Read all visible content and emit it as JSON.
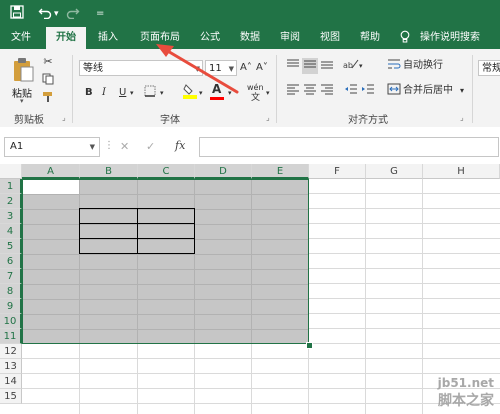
{
  "quick_access": {
    "save_icon": "save-icon",
    "undo_icon": "undo-icon",
    "undo_dropdown": "▾",
    "redo_icon": "redo-icon",
    "customize": "="
  },
  "tabs": [
    {
      "label": "文件",
      "active": false
    },
    {
      "label": "开始",
      "active": true
    },
    {
      "label": "插入",
      "active": false
    },
    {
      "label": "页面布局",
      "active": false
    },
    {
      "label": "公式",
      "active": false
    },
    {
      "label": "数据",
      "active": false
    },
    {
      "label": "审阅",
      "active": false
    },
    {
      "label": "视图",
      "active": false
    },
    {
      "label": "帮助",
      "active": false
    }
  ],
  "search": {
    "icon": "lightbulb-icon",
    "label": "操作说明搜索"
  },
  "ribbon": {
    "clipboard": {
      "paste_label": "粘贴",
      "group_label": "剪贴板"
    },
    "font": {
      "font_name": "等线",
      "font_size": "11",
      "grow": "A˄",
      "shrink": "A˅",
      "bold": "B",
      "italic": "I",
      "underline": "U",
      "fill_letter": "A",
      "phonetic": "wén",
      "group_label": "字体",
      "fill_color": "#ffff00",
      "font_color": "#ff0000"
    },
    "alignment": {
      "wrap_text": "自动换行",
      "merge_center": "合并后居中",
      "merge_dropdown": "▾",
      "group_label": "对齐方式"
    },
    "number": {
      "format": "常规"
    }
  },
  "formula_bar": {
    "name_box": "A1",
    "cancel": "✕",
    "enter": "✓",
    "fx": "fx",
    "content": ""
  },
  "sheet": {
    "columns": [
      "A",
      "B",
      "C",
      "D",
      "E",
      "F",
      "G",
      "H"
    ],
    "rows": [
      "1",
      "2",
      "3",
      "4",
      "5",
      "6",
      "7",
      "8",
      "9",
      "10",
      "11",
      "12",
      "13",
      "14",
      "15"
    ],
    "selection": "A1:E11",
    "active_cell": "A1",
    "bordered_range": "B3:C5",
    "selection_color": "#c6c6c6",
    "accent_color": "#217346"
  },
  "watermark": {
    "line1": "jb51.net",
    "line2": "脚本之家"
  },
  "annotation": {
    "color": "#e84c3d",
    "points_to": "页面布局"
  }
}
